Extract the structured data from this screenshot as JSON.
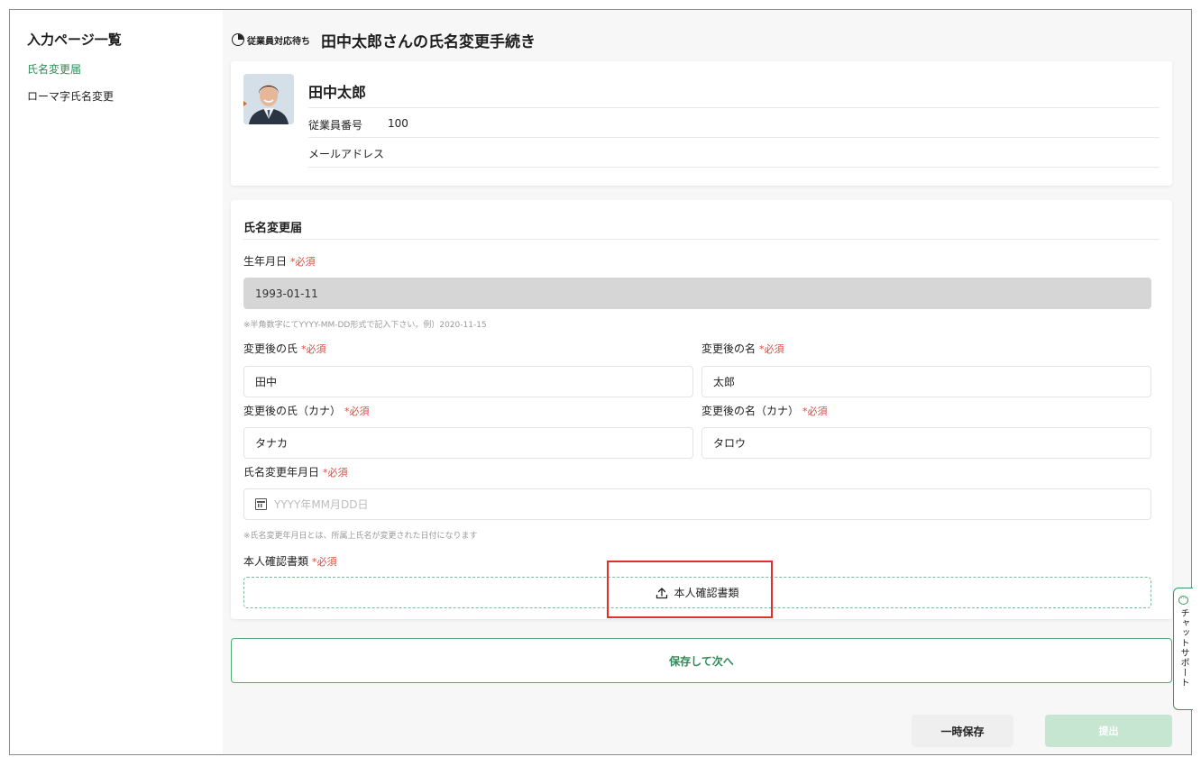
{
  "sidebar": {
    "title": "入力ページ一覧",
    "items": [
      {
        "label": "氏名変更届",
        "active": true
      },
      {
        "label": "ローマ字氏名変更",
        "active": false
      }
    ]
  },
  "header": {
    "status": "従業員対応待ち",
    "title": "田中太郎さんの氏名変更手続き"
  },
  "profile": {
    "name": "田中太郎",
    "employee_number_label": "従業員番号",
    "employee_number": "100",
    "email_label": "メールアドレス",
    "email": ""
  },
  "form": {
    "section_title": "氏名変更届",
    "required_text": "*必須",
    "birthdate": {
      "label": "生年月日",
      "value": "1993-01-11",
      "hint": "※半角数字にてYYYY-MM-DD形式で記入下さい。例）2020-11-15"
    },
    "last_name": {
      "label": "変更後の氏",
      "value": "田中"
    },
    "first_name": {
      "label": "変更後の名",
      "value": "太郎"
    },
    "last_name_kana": {
      "label": "変更後の氏（カナ）",
      "value": "タナカ"
    },
    "first_name_kana": {
      "label": "変更後の名（カナ）",
      "value": "タロウ"
    },
    "change_date": {
      "label": "氏名変更年月日",
      "placeholder": "YYYY年MM月DD日",
      "hint": "※氏名変更年月日とは、所属上氏名が変更された日付になります"
    },
    "id_document": {
      "label": "本人確認書類",
      "upload_label": "本人確認書類"
    }
  },
  "buttons": {
    "save_next": "保存して次へ",
    "temp_save": "一時保存",
    "submit": "提出"
  },
  "chat": {
    "label": "チャットサポート"
  },
  "colors": {
    "accent": "#2e8b57",
    "required": "#e0483e",
    "highlight": "#e0302a",
    "submit_disabled": "#c6e6d2"
  }
}
